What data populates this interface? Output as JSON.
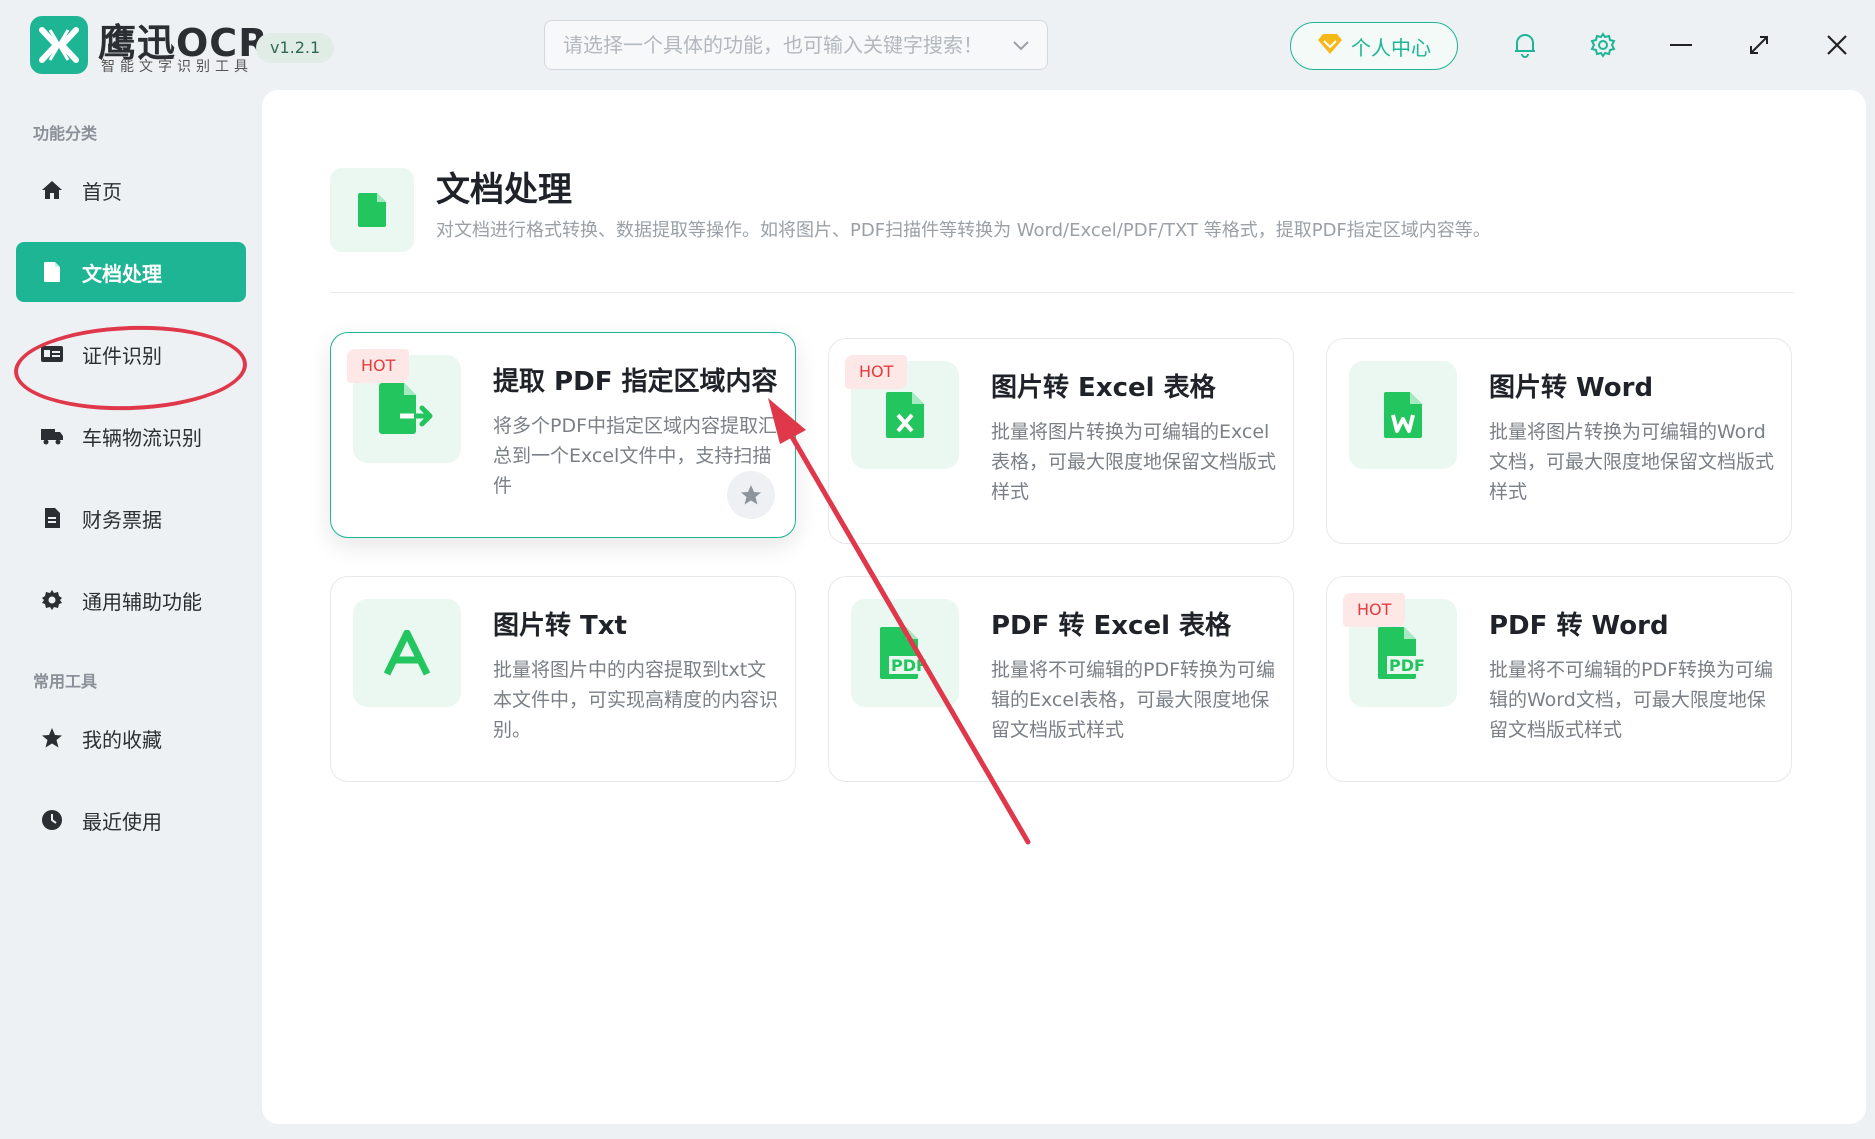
{
  "app": {
    "brand_name": "鹰迅OCR",
    "brand_sub": "智能文字识别工具",
    "version": "v1.2.1"
  },
  "search": {
    "placeholder": "请选择一个具体的功能，也可输入关键字搜索！"
  },
  "toolbar": {
    "user_center_label": "个人中心"
  },
  "colors": {
    "accent": "#1db594",
    "hot": "#e53b3b",
    "annotation": "#e0384b"
  },
  "sidebar": {
    "section1": "功能分类",
    "section2": "常用工具",
    "items": [
      {
        "label": "首页",
        "icon": "home-icon"
      },
      {
        "label": "文档处理",
        "icon": "document-icon",
        "active": true
      },
      {
        "label": "证件识别",
        "icon": "id-card-icon"
      },
      {
        "label": "车辆物流识别",
        "icon": "truck-icon"
      },
      {
        "label": "财务票据",
        "icon": "receipt-icon"
      },
      {
        "label": "通用辅助功能",
        "icon": "gear-icon"
      }
    ],
    "tools": [
      {
        "label": "我的收藏",
        "icon": "star-icon"
      },
      {
        "label": "最近使用",
        "icon": "clock-icon"
      }
    ]
  },
  "header": {
    "title": "文档处理",
    "description": "对文档进行格式转换、数据提取等操作。如将图片、PDF扫描件等转换为 Word/Excel/PDF/TXT 等格式，提取PDF指定区域内容等。"
  },
  "cards": [
    {
      "title": "提取 PDF 指定区域内容",
      "desc": "将多个PDF中指定区域内容提取汇总到一个Excel文件中，支持扫描件",
      "hot": "HOT",
      "icon": "file-export-icon"
    },
    {
      "title": "图片转 Excel 表格",
      "desc": "批量将图片转换为可编辑的Excel表格，可最大限度地保留文档版式样式",
      "hot": "HOT",
      "icon": "excel-file-icon"
    },
    {
      "title": "图片转 Word",
      "desc": "批量将图片转换为可编辑的Word文档，可最大限度地保留文档版式样式",
      "hot": "",
      "icon": "word-file-icon"
    },
    {
      "title": "图片转 Txt",
      "desc": "批量将图片中的内容提取到txt文本文件中，可实现高精度的内容识别。",
      "hot": "",
      "icon": "text-a-icon"
    },
    {
      "title": "PDF 转 Excel 表格",
      "desc": "批量将不可编辑的PDF转换为可编辑的Excel表格，可最大限度地保留文档版式样式",
      "hot": "",
      "icon": "pdf-file-icon"
    },
    {
      "title": "PDF 转 Word",
      "desc": "批量将不可编辑的PDF转换为可编辑的Word文档，可最大限度地保留文档版式样式",
      "hot": "HOT",
      "icon": "pdf-file-icon"
    }
  ]
}
